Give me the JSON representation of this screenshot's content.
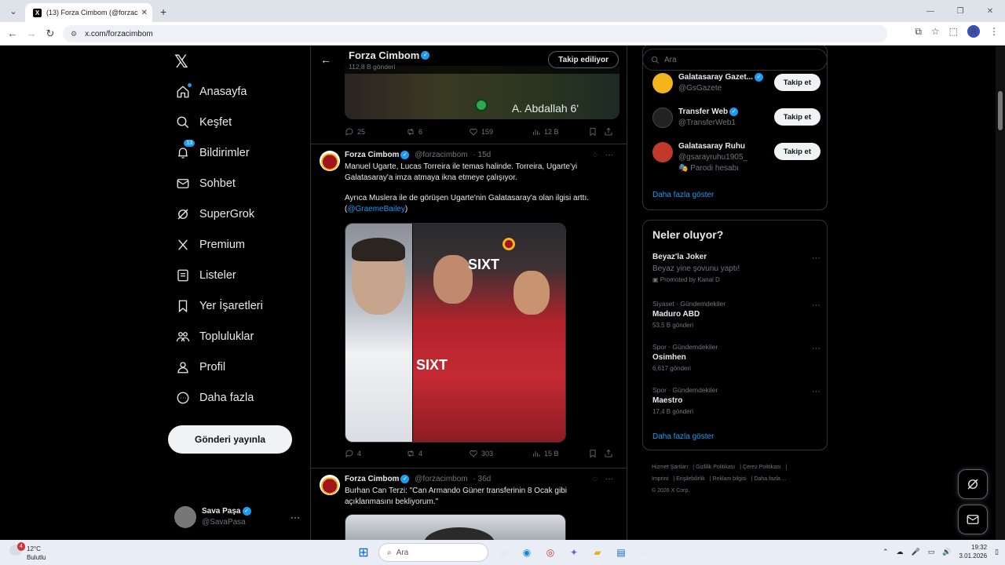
{
  "browser": {
    "tab_title": "(13) Forza Cimbom (@forzacim",
    "url": "x.com/forzacimbom",
    "tab_favicon": "X",
    "profile_initial": "A"
  },
  "nav": {
    "items": [
      {
        "label": "Anasayfa",
        "icon": "home-icon"
      },
      {
        "label": "Keşfet",
        "icon": "search-icon"
      },
      {
        "label": "Bildirimler",
        "icon": "bell-icon",
        "badge": "13"
      },
      {
        "label": "Sohbet",
        "icon": "mail-icon"
      },
      {
        "label": "SuperGrok",
        "icon": "grok-icon"
      },
      {
        "label": "Premium",
        "icon": "x-icon"
      },
      {
        "label": "Listeler",
        "icon": "list-icon"
      },
      {
        "label": "Yer İşaretleri",
        "icon": "bookmark-icon"
      },
      {
        "label": "Topluluklar",
        "icon": "people-icon"
      },
      {
        "label": "Profil",
        "icon": "person-icon"
      },
      {
        "label": "Daha fazla",
        "icon": "more-circle-icon"
      }
    ],
    "post_button": "Gönderi yayınla",
    "me": {
      "name": "Sava Paşa",
      "handle": "@SavaPasa"
    }
  },
  "profile_header": {
    "name": "Forza Cimbom",
    "post_count": "112,8 B gönderi",
    "follow_label": "Takip ediliyor"
  },
  "top_media": {
    "score_text": "A. Abdallah 6'"
  },
  "tweets": [
    {
      "stats": {
        "replies": "25",
        "retweets": "6",
        "likes": "159",
        "views": "12 B"
      }
    },
    {
      "name": "Forza Cimbom",
      "handle": "@forzacimbom",
      "age": "15d",
      "text1": "Manuel Ugarte, Lucas Torreira ile temas halinde. Torreira, Ugarte'yi Galatasaray'a imza atmaya ikna etmeye çalışıyor.",
      "text2_pre": "Ayrıca Muslera ile de görüşen Ugarte'nin Galatasaray'a olan ilgisi arttı. (",
      "text2_link": "@GraemeBailey",
      "text2_post": ")",
      "stats": {
        "replies": "4",
        "retweets": "4",
        "likes": "303",
        "views": "15 B"
      }
    },
    {
      "name": "Forza Cimbom",
      "handle": "@forzacimbom",
      "age": "36d",
      "text1": "Burhan Can Terzi: \"Can Armando Güner transferinin 8 Ocak gibi açıklanmasını bekliyorum.\""
    }
  ],
  "right": {
    "search_placeholder": "Ara",
    "who_to_follow": [
      {
        "name": "Galatasaray Gazet...",
        "handle": "@GsGazete",
        "button": "Takip et",
        "avatar_color": "#f3b519"
      },
      {
        "name": "Transfer Web",
        "handle": "@TransferWeb1",
        "button": "Takip et",
        "avatar_color": "#222222"
      },
      {
        "name": "Galatasaray Ruhu",
        "handle": "@gsarayruhu1905_",
        "badge": "Parodi hesabı",
        "button": "Takip et",
        "avatar_color": "#c0392b"
      }
    ],
    "show_more": "Daha fazla göster",
    "trends_title": "Neler oluyor?",
    "trends": [
      {
        "title": "Beyaz'la Joker",
        "subtitle": "Beyaz yine şovunu yaptı!",
        "promoted": "Promoted by Kanal D"
      },
      {
        "context": "Siyaset · Gündemdekiler",
        "title": "Maduro ABD",
        "count": "53,5 B gönderi"
      },
      {
        "context": "Spor · Gündemdekiler",
        "title": "Osimhen",
        "count": "6,617 gönderi"
      },
      {
        "context": "Spor · Gündemdekiler",
        "title": "Maestro",
        "count": "17,4 B gönderi"
      }
    ],
    "show_more2": "Daha fazla göster",
    "footer": [
      "Hizmet Şartları",
      "Gizlilik Politikası",
      "Çerez Politikası",
      "Imprint",
      "Erişilebilirlik",
      "Reklam bilgisi",
      "Daha fazla ...",
      "© 2026 X Corp."
    ]
  },
  "taskbar": {
    "weather_temp": "12°C",
    "weather_desc": "Bulutlu",
    "weather_badge": "4",
    "search_placeholder": "Ara",
    "time": "19:32",
    "date": "3.01.2026"
  },
  "colors": {
    "accent": "#1d9bf0",
    "bg": "#000000",
    "border": "#2f3336",
    "muted": "#71767b"
  }
}
